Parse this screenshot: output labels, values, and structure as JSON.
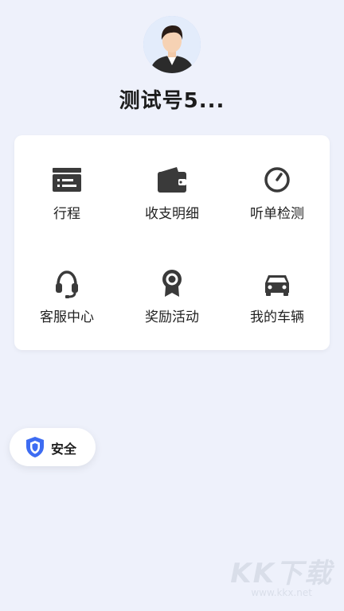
{
  "profile": {
    "name": "测试号5..."
  },
  "menu": {
    "items": [
      {
        "label": "行程",
        "icon": "itinerary-icon"
      },
      {
        "label": "收支明细",
        "icon": "wallet-icon"
      },
      {
        "label": "听单检测",
        "icon": "gauge-icon"
      },
      {
        "label": "客服中心",
        "icon": "headset-icon"
      },
      {
        "label": "奖励活动",
        "icon": "award-icon"
      },
      {
        "label": "我的车辆",
        "icon": "car-icon"
      }
    ]
  },
  "safety": {
    "label": "安全",
    "icon": "shield-icon",
    "accent": "#3d6cf2"
  },
  "watermark": {
    "logo": "KK下载",
    "url": "www.kkx.net"
  },
  "colors": {
    "background": "#eef1fb",
    "icon": "#3a3a3a",
    "card": "#ffffff"
  }
}
